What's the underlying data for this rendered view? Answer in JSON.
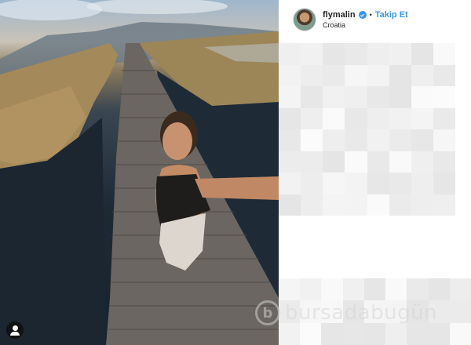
{
  "post": {
    "username": "flymalin",
    "separator": "•",
    "follow_label": "Takip Et",
    "location": "Croatia"
  },
  "watermark": {
    "logo_letter": "b",
    "text": "bursadabugün"
  },
  "icons": {
    "verified": "verified-badge-icon",
    "tagged_user": "user-tag-icon"
  },
  "colors": {
    "accent": "#3897f0",
    "text": "#262626"
  }
}
